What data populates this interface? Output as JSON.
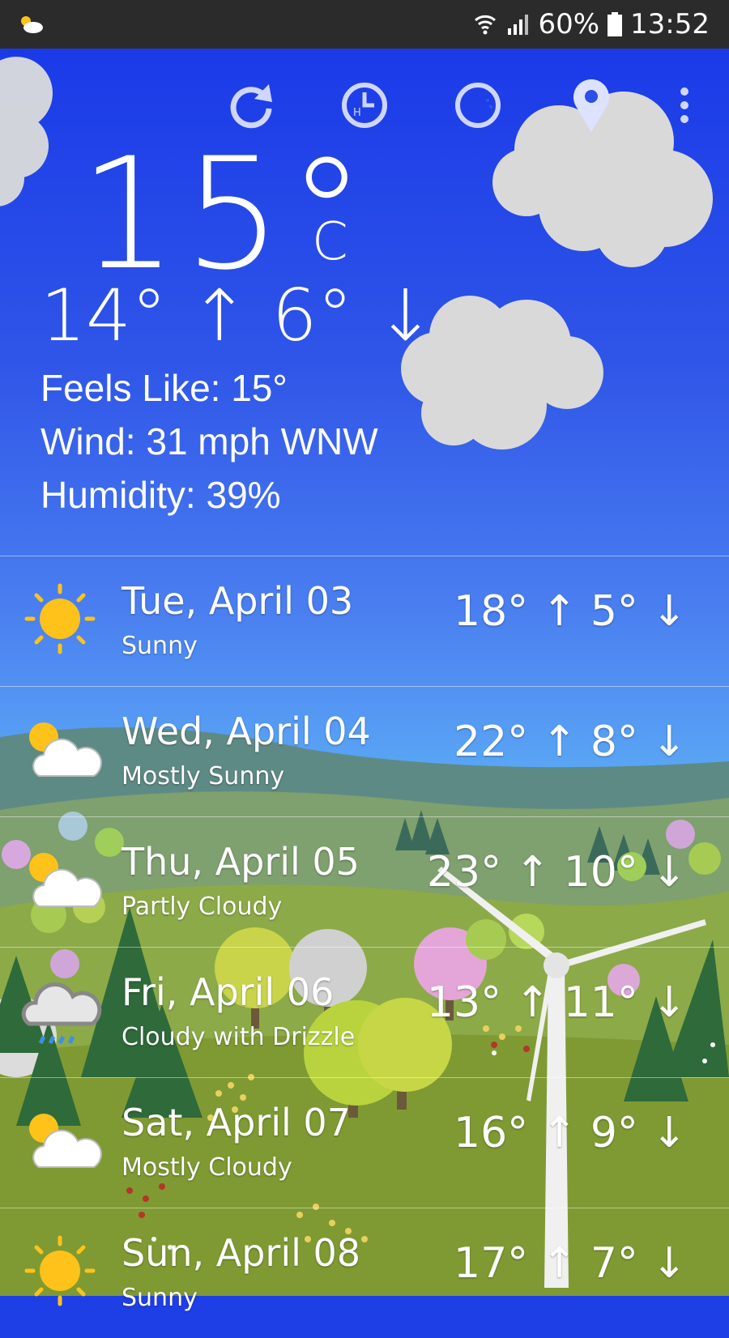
{
  "status_bar": {
    "battery": "60%",
    "time": "13:52"
  },
  "toolbar": {
    "refresh_icon": "refresh-icon",
    "hourly_icon": "hourly-clock-icon",
    "moon_icon": "moon-phase-icon",
    "location_icon": "location-pin-icon",
    "menu_icon": "more-vert-icon"
  },
  "current": {
    "temperature": "15°",
    "unit": "C",
    "hi_lo": "14° ↑ 6° ↓",
    "feels_like": "Feels Like: 15°",
    "wind": "Wind: 31 mph WNW",
    "humidity": "Humidity: 39%"
  },
  "forecast": [
    {
      "day": "Tue, April 03",
      "condition": "Sunny",
      "temps": "18° ↑ 5° ↓",
      "icon": "sun-icon"
    },
    {
      "day": "Wed, April 04",
      "condition": "Mostly Sunny",
      "temps": "22° ↑ 8° ↓",
      "icon": "sun-cloud-icon"
    },
    {
      "day": "Thu, April 05",
      "condition": "Partly Cloudy",
      "temps": "23° ↑ 10° ↓",
      "icon": "sun-cloud-icon"
    },
    {
      "day": "Fri, April 06",
      "condition": "Cloudy with Drizzle",
      "temps": "13° ↑ 11° ↓",
      "icon": "drizzle-cloud-icon"
    },
    {
      "day": "Sat, April 07",
      "condition": "Mostly Cloudy",
      "temps": "16° ↑ 9° ↓",
      "icon": "sun-cloud-icon"
    },
    {
      "day": "Sun, April 08",
      "condition": "Sunny",
      "temps": "17° ↑ 7° ↓",
      "icon": "sun-icon"
    }
  ],
  "colors": {
    "sky_top": "#1a3ae8",
    "sky_mid": "#5aa6f5",
    "grass": "#7f9a33",
    "sun": "#ffc21a"
  }
}
